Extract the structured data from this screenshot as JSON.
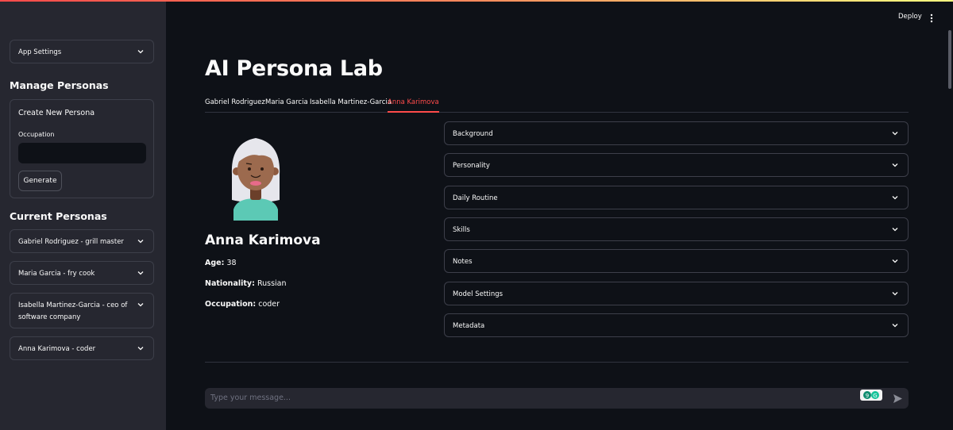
{
  "header": {
    "deploy_label": "Deploy",
    "menu_icon": "kebab-menu-icon"
  },
  "sidebar": {
    "app_settings_label": "App Settings",
    "manage_heading": "Manage Personas",
    "create_form": {
      "title": "Create New Persona",
      "occupation_label": "Occupation",
      "occupation_value": "",
      "generate_label": "Generate"
    },
    "current_heading": "Current Personas",
    "personas": [
      {
        "label": "Gabriel Rodriguez - grill master"
      },
      {
        "label": "Maria Garcia - fry cook"
      },
      {
        "label": "Isabella Martinez-Garcia - ceo of software company"
      },
      {
        "label": "Anna Karimova - coder"
      }
    ]
  },
  "main": {
    "title": "AI Persona Lab",
    "tabs": [
      {
        "label": "Gabriel Rodriguez"
      },
      {
        "label": "Maria Garcia"
      },
      {
        "label": "Isabella Martinez-Garcia"
      },
      {
        "label": "Anna Karimova",
        "active": true
      }
    ],
    "persona": {
      "name": "Anna Karimova",
      "age_label": "Age:",
      "age_value": "38",
      "nationality_label": "Nationality:",
      "nationality_value": "Russian",
      "occupation_label": "Occupation:",
      "occupation_value": "coder"
    },
    "sections": [
      {
        "label": "Background"
      },
      {
        "label": "Personality"
      },
      {
        "label": "Daily Routine"
      },
      {
        "label": "Skills"
      },
      {
        "label": "Notes"
      },
      {
        "label": "Model Settings"
      },
      {
        "label": "Metadata"
      }
    ],
    "chat": {
      "placeholder": "Type your message..."
    }
  },
  "colors": {
    "accent": "#ff4b4b",
    "background": "#0e1117",
    "sidebar": "#262730"
  }
}
